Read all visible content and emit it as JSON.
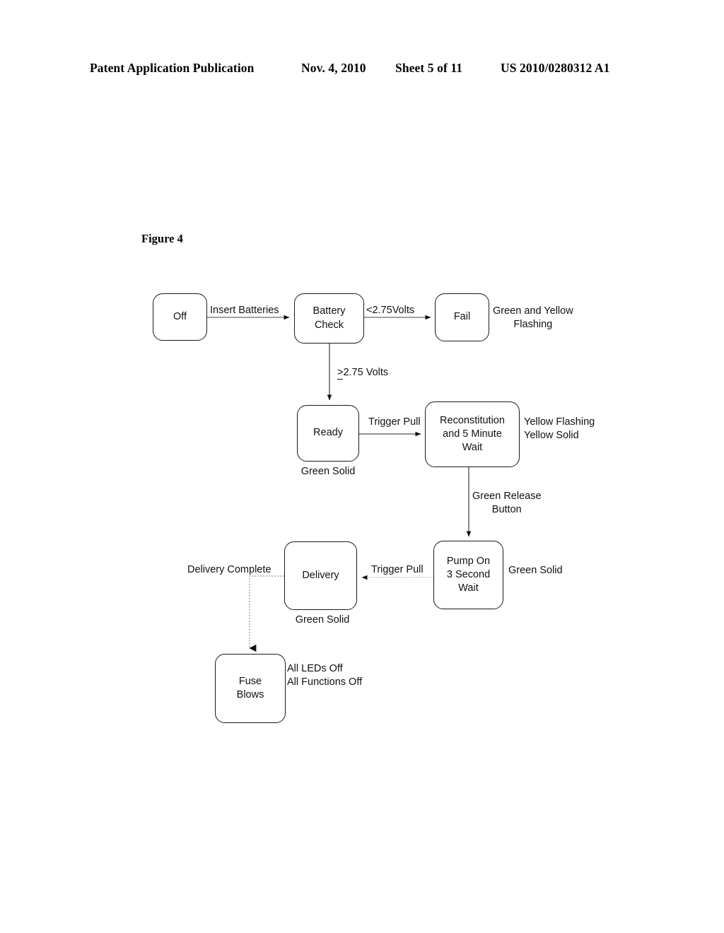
{
  "header": {
    "publication": "Patent Application Publication",
    "date": "Nov. 4, 2010",
    "sheet": "Sheet 5 of 11",
    "number": "US 2010/0280312 A1"
  },
  "figure": {
    "caption": "Figure 4"
  },
  "chart_data": {
    "type": "diagram",
    "title": "Figure 4",
    "diagram_kind": "state-machine-flowchart",
    "nodes": [
      {
        "id": "off",
        "label": "Off",
        "status": ""
      },
      {
        "id": "battery_check",
        "label": "Battery\nCheck",
        "status": ""
      },
      {
        "id": "fail",
        "label": "Fail",
        "status": "Green and Yellow\nFlashing"
      },
      {
        "id": "ready",
        "label": "Ready",
        "status": "Green Solid"
      },
      {
        "id": "reconstitution",
        "label": "Reconstitution\nand 5 Minute\nWait",
        "status": "Yellow Flashing\nYellow Solid"
      },
      {
        "id": "pump_on",
        "label": "Pump On\n3 Second\nWait",
        "status": "Green Solid"
      },
      {
        "id": "delivery",
        "label": "Delivery",
        "status": "Green Solid"
      },
      {
        "id": "fuse_blows",
        "label": "Fuse\nBlows",
        "status": "All LEDs Off\nAll Functions Off"
      }
    ],
    "edges": [
      {
        "from": "off",
        "to": "battery_check",
        "label": "Insert Batteries",
        "style": "solid"
      },
      {
        "from": "battery_check",
        "to": "fail",
        "label": "<2.75Volts",
        "style": "solid"
      },
      {
        "from": "battery_check",
        "to": "ready",
        "label": "≥2.75 Volts",
        "style": "solid"
      },
      {
        "from": "ready",
        "to": "reconstitution",
        "label": "Trigger Pull",
        "style": "solid"
      },
      {
        "from": "reconstitution",
        "to": "pump_on",
        "label": "Green Release\nButton",
        "style": "solid"
      },
      {
        "from": "pump_on",
        "to": "delivery",
        "label": "Trigger Pull",
        "style": "solid"
      },
      {
        "from": "delivery",
        "to": "fuse_blows",
        "label": "Delivery Complete",
        "style": "dotted"
      }
    ]
  },
  "nodes": {
    "off": {
      "line1": "Off"
    },
    "battery_check": {
      "line1": "Battery",
      "line2": "Check"
    },
    "fail": {
      "line1": "Fail"
    },
    "ready": {
      "line1": "Ready"
    },
    "reconstitution": {
      "line1": "Reconstitution",
      "line2": "and 5 Minute",
      "line3": "Wait"
    },
    "pump_on": {
      "line1": "Pump On",
      "line2": "3 Second",
      "line3": "Wait"
    },
    "delivery": {
      "line1": "Delivery"
    },
    "fuse_blows": {
      "line1": "Fuse",
      "line2": "Blows"
    }
  },
  "edge_labels": {
    "insert_batteries": "Insert Batteries",
    "under_voltage": "<2.75Volts",
    "over_voltage_value": "2.75 Volts",
    "trigger_pull_1": "Trigger Pull",
    "green_release_l1": "Green Release",
    "green_release_l2": "Button",
    "trigger_pull_2": "Trigger Pull",
    "delivery_complete": "Delivery Complete"
  },
  "annotations": {
    "fail_l1": "Green and Yellow",
    "fail_l2": "Flashing",
    "ready_status": "Green Solid",
    "reconstitution_l1": "Yellow Flashing",
    "reconstitution_l2": "Yellow Solid",
    "pump_status": "Green Solid",
    "delivery_status": "Green Solid",
    "fuse_l1": "All LEDs Off",
    "fuse_l2": "All Functions Off"
  }
}
